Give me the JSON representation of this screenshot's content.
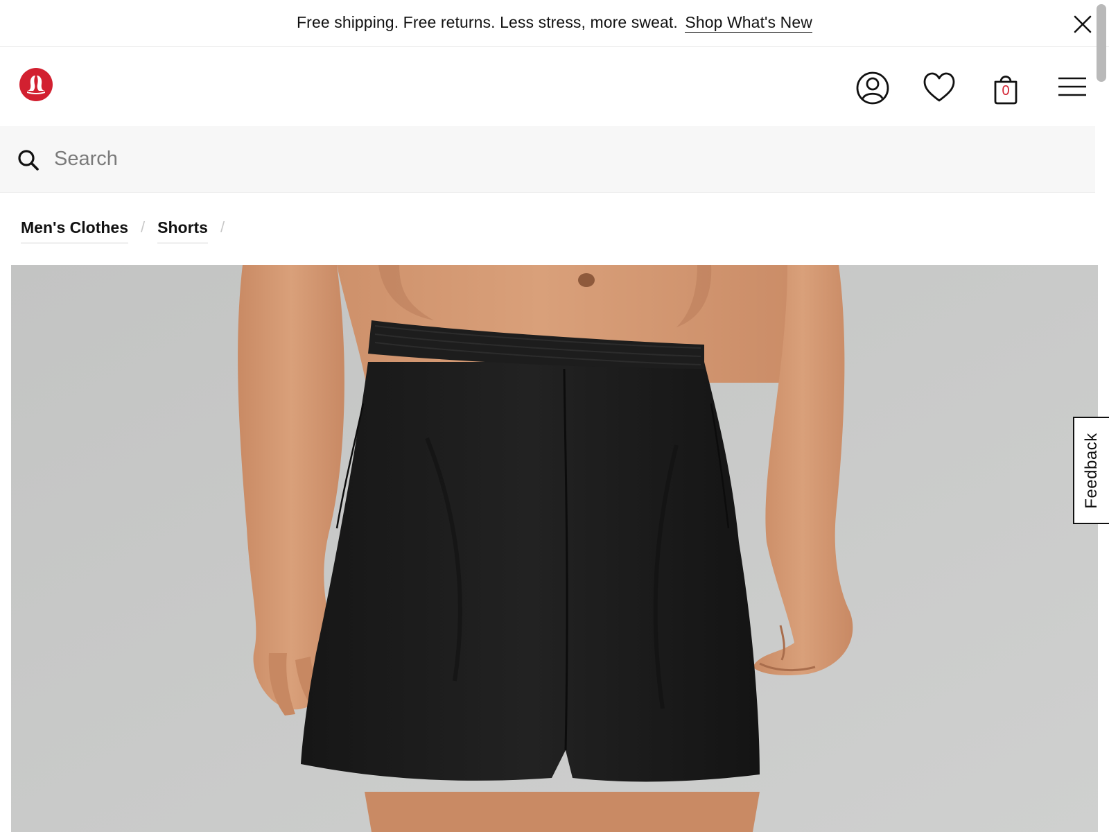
{
  "promo": {
    "message": "Free shipping. Free returns. Less stress, more sweat.",
    "link_label": "Shop What's New",
    "close_icon": "close-icon"
  },
  "header": {
    "logo_icon": "lululemon-logo",
    "icons": [
      "account-icon",
      "heart-icon",
      "shopping-bag-icon",
      "hamburger-menu-icon"
    ],
    "bag_count": "0"
  },
  "search": {
    "placeholder": "Search",
    "icon": "search-icon"
  },
  "breadcrumb": {
    "items": [
      {
        "label": "Men's Clothes"
      },
      {
        "label": "Shorts"
      }
    ],
    "separator": "/"
  },
  "feedback": {
    "label": "Feedback"
  },
  "colors": {
    "brand_red": "#d22030",
    "text": "#111111",
    "search_bg": "#f7f7f7",
    "image_bg": "#c9cac9"
  }
}
